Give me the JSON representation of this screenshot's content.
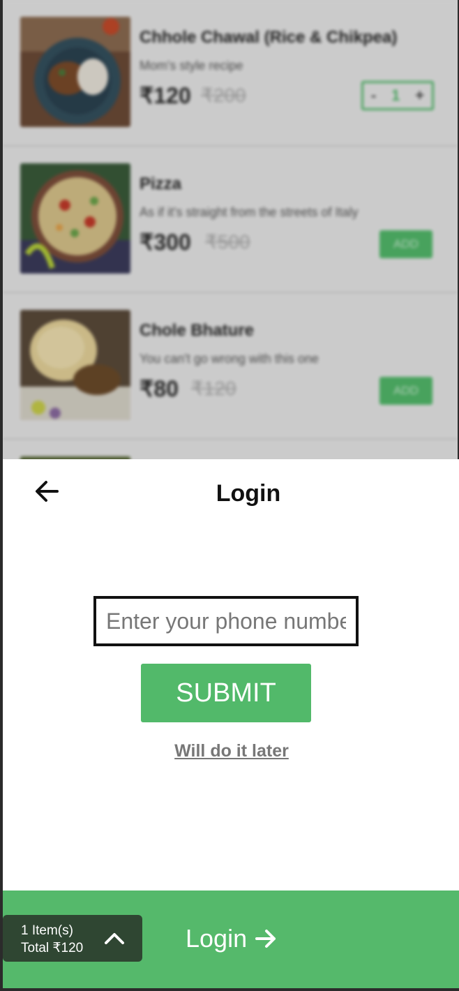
{
  "menu": {
    "items": [
      {
        "name": "Chhole Chawal (Rice & Chikpea)",
        "description": "Mom's style recipe",
        "price": "₹120",
        "mrp": "₹200",
        "quantity": "1",
        "minus": "-",
        "plus": "+"
      },
      {
        "name": "Pizza",
        "description": "As if it's straight from the streets of Italy",
        "price": "₹300",
        "mrp": "₹500",
        "add_label": "ADD"
      },
      {
        "name": "Chole Bhature",
        "description": "You can't go wrong with this one",
        "price": "₹80",
        "mrp": "₹120",
        "add_label": "ADD"
      }
    ]
  },
  "login_sheet": {
    "title": "Login",
    "phone_placeholder": "Enter your phone number",
    "submit_label": "SUBMIT",
    "later_label": "Will do it later",
    "icons": {
      "back": "arrow-left-icon"
    }
  },
  "bottom_bar": {
    "item_count": "1 Item(s)",
    "total": "Total ₹120",
    "login_label": "Login",
    "icons": {
      "expand": "chevron-up-icon",
      "login": "arrow-right-icon"
    }
  },
  "colors": {
    "accent": "#52b96a",
    "cart_summary_bg": "#2f4632",
    "sheet_bg": "#ffffff"
  }
}
